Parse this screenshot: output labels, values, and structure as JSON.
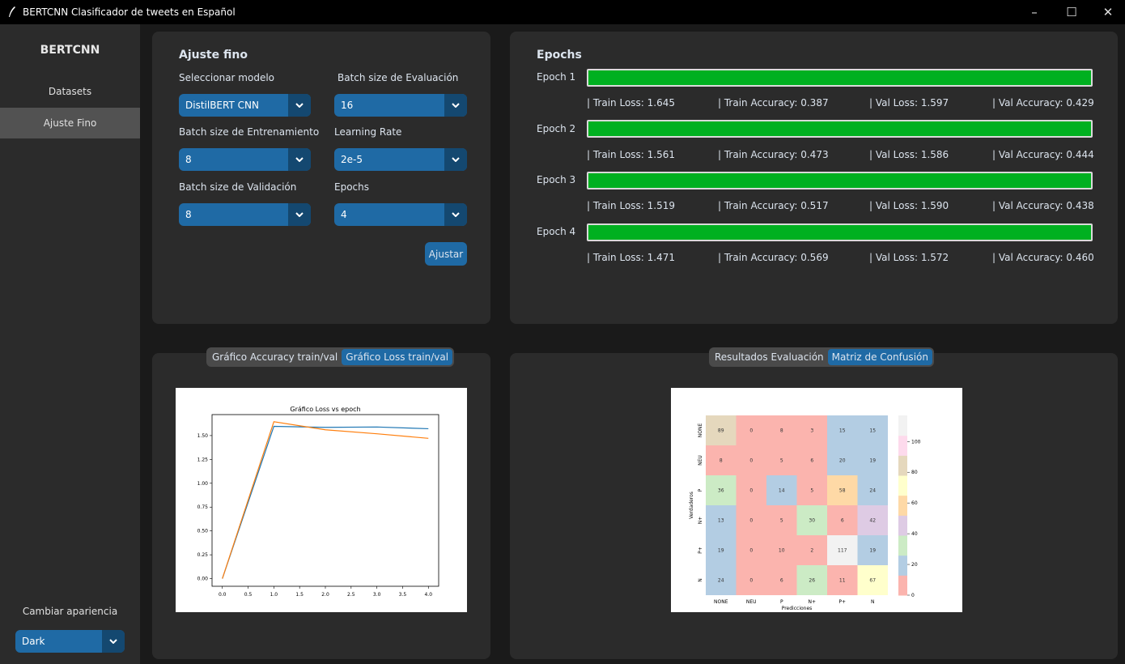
{
  "window": {
    "title": "BERTCNN Clasificador de tweets en Español"
  },
  "sidebar": {
    "brand": "BERTCNN",
    "items": [
      {
        "label": "Datasets"
      },
      {
        "label": "Ajuste Fino"
      }
    ],
    "appearance_label": "Cambiar apariencia",
    "appearance_value": "Dark"
  },
  "tuning": {
    "title": "Ajuste fino",
    "model_label": "Seleccionar modelo",
    "model_value": "DistilBERT CNN",
    "eval_batch_label": "Batch size de Evaluación",
    "eval_batch_value": "16",
    "train_batch_label": "Batch size de Entrenamiento",
    "train_batch_value": "8",
    "lr_label": "Learning Rate",
    "lr_value": "2e-5",
    "val_batch_label": "Batch size de Validación",
    "val_batch_value": "8",
    "epochs_label": "Epochs",
    "epochs_value": "4",
    "button_label": "Ajustar"
  },
  "epochs_panel": {
    "title": "Epochs",
    "progress_color": "#00b020",
    "rows": [
      {
        "label": "Epoch 1",
        "progress": 1.0,
        "train_loss": "| Train Loss:  1.645",
        "train_acc": "| Train Accuracy:  0.387",
        "val_loss": "| Val Loss:  1.597",
        "val_acc": "| Val Accuracy:  0.429"
      },
      {
        "label": "Epoch 2",
        "progress": 1.0,
        "train_loss": "| Train Loss:  1.561",
        "train_acc": "| Train Accuracy:  0.473",
        "val_loss": "| Val Loss:  1.586",
        "val_acc": "| Val Accuracy:  0.444"
      },
      {
        "label": "Epoch 3",
        "progress": 1.0,
        "train_loss": "| Train Loss:  1.519",
        "train_acc": "| Train Accuracy:  0.517",
        "val_loss": "| Val Loss:  1.590",
        "val_acc": "| Val Accuracy:  0.438"
      },
      {
        "label": "Epoch 4",
        "progress": 1.0,
        "train_loss": "| Train Loss:  1.471",
        "train_acc": "| Train Accuracy:  0.569",
        "val_loss": "| Val Loss:  1.572",
        "val_acc": "| Val Accuracy:  0.460"
      }
    ]
  },
  "left_tabs": {
    "options": [
      "Gráfico Accuracy train/val",
      "Gráfico Loss train/val"
    ],
    "selected": "Gráfico Loss train/val"
  },
  "right_tabs": {
    "options": [
      "Resultados Evaluación",
      "Matriz de Confusión"
    ],
    "selected": "Matriz de Confusión"
  },
  "chart_data": [
    {
      "type": "line",
      "title": "Gráfico Loss vs epoch",
      "xlabel": "",
      "ylabel": "",
      "xlim": [
        -0.2,
        4.2
      ],
      "ylim": [
        -0.08,
        1.72
      ],
      "xticks": [
        "0.0",
        "0.5",
        "1.0",
        "1.5",
        "2.0",
        "2.5",
        "3.0",
        "3.5",
        "4.0"
      ],
      "yticks": [
        "0.00",
        "0.25",
        "0.50",
        "0.75",
        "1.00",
        "1.25",
        "1.50"
      ],
      "x": [
        0,
        1,
        2,
        3,
        4
      ],
      "series": [
        {
          "color": "#1f77b4",
          "values": [
            0,
            1.597,
            1.586,
            1.59,
            1.572
          ]
        },
        {
          "color": "#ff7f0e",
          "values": [
            0,
            1.645,
            1.561,
            1.519,
            1.471
          ]
        }
      ],
      "grid": false
    },
    {
      "type": "heatmap",
      "xlabel": "Predicciones",
      "ylabel": "Verdaderos",
      "categories": [
        "NONE",
        "NEU",
        "P",
        "N+",
        "P+",
        "N"
      ],
      "values": [
        [
          89,
          0,
          8,
          3,
          15,
          15
        ],
        [
          8,
          0,
          5,
          6,
          20,
          19
        ],
        [
          36,
          0,
          14,
          5,
          58,
          24
        ],
        [
          13,
          0,
          5,
          30,
          6,
          42
        ],
        [
          19,
          0,
          10,
          2,
          117,
          19
        ],
        [
          24,
          0,
          6,
          26,
          11,
          67
        ]
      ],
      "colorbar_ticks": [
        "0",
        "20",
        "40",
        "60",
        "80",
        "100"
      ],
      "colorbar_range": [
        0,
        117
      ],
      "colormap": "Pastel1"
    }
  ]
}
